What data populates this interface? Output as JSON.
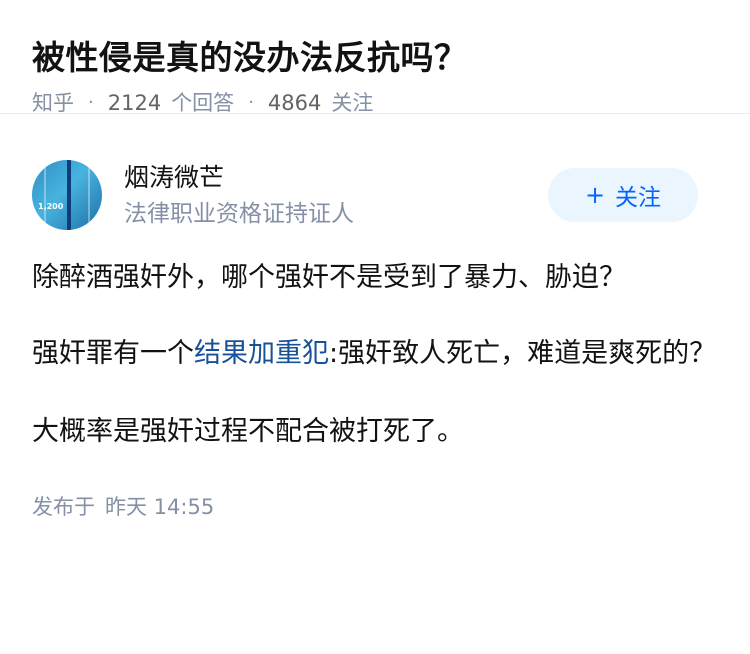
{
  "question": {
    "title": "被性侵是真的没办法反抗吗？",
    "source": "知乎",
    "separator": "·",
    "answer_count": "2124",
    "answer_label": "个回答",
    "follower_count": "4864",
    "follower_label": "关注"
  },
  "author": {
    "name": "烟涛微芒",
    "headline": "法律职业资格证持证人",
    "avatar_text": "1,200"
  },
  "follow_button": {
    "icon": "+",
    "label": "关注"
  },
  "content": {
    "p1": "除醉酒强奸外，哪个强奸不是受到了暴力、胁迫？",
    "p2_prefix": "强奸罪有一个",
    "p2_link": "结果加重犯",
    "p2_suffix": ":强奸致人死亡，难道是爽死的？",
    "p3": "大概率是强奸过程不配合被打死了。"
  },
  "publish": {
    "label": "发布于",
    "time": "昨天 14:55"
  },
  "colors": {
    "link": "#175199",
    "accent": "#0066ff",
    "meta": "#8590a6"
  }
}
